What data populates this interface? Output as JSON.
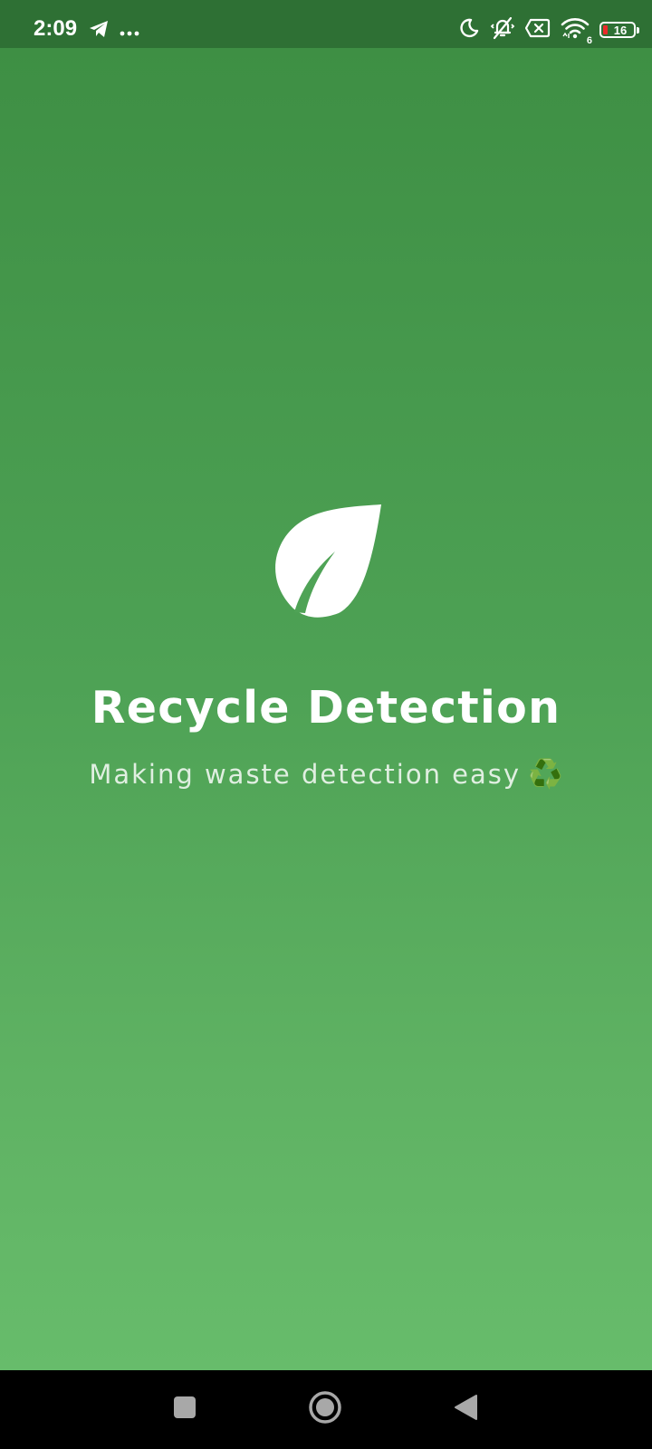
{
  "status_bar": {
    "time": "2:09",
    "left_icons": [
      "telegram-icon",
      "more-dots-icon"
    ],
    "right_icons": [
      "moon-icon",
      "silent-bell-icon",
      "sim-off-icon",
      "wifi-icon"
    ],
    "wifi_badge": "6",
    "battery_level": "16",
    "battery_level_fraction": 0.16
  },
  "splash": {
    "logo_icon": "leaf-icon",
    "title": "Recycle Detection",
    "tagline": "Making waste detection easy",
    "tagline_emoji": "♻️"
  },
  "nav_bar": {
    "buttons": [
      "recents-square-icon",
      "home-circle-icon",
      "back-triangle-icon"
    ]
  },
  "colors": {
    "status_bar": "#2e7034",
    "gradient_top": "#3e8f44",
    "gradient_bottom": "#67bc6b",
    "battery_low": "#ea2b2b",
    "text": "#ffffff"
  }
}
